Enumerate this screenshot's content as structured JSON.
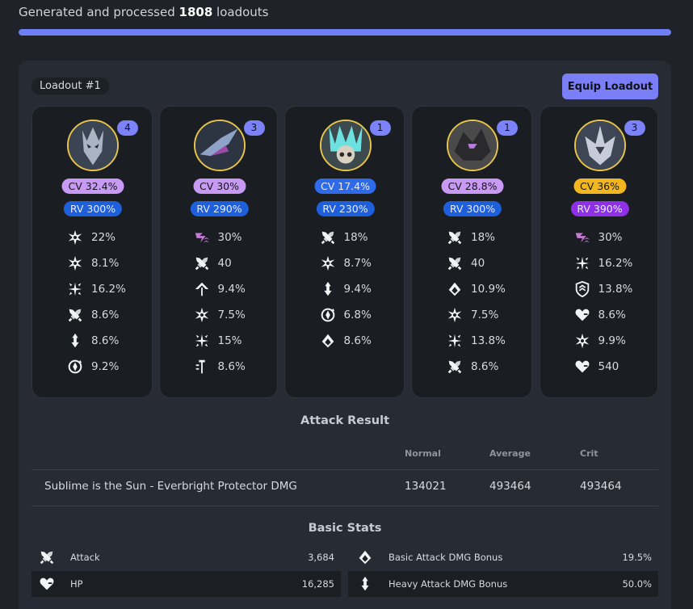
{
  "header": {
    "generated_prefix": "Generated and processed",
    "generated_count": "1808",
    "generated_suffix": "loadouts",
    "progress": 1.0
  },
  "loadout": {
    "tag": "Loadout #1",
    "equip_label": "Equip Loadout"
  },
  "colors": {
    "accent": "#7a7ff7",
    "avatar_ring": "#e7c44a",
    "cv_purple": "#c99af4",
    "cv_blue": "#2f6ae9",
    "cv_gold": "#f2b71e",
    "rv_blue": "#1e5fdc",
    "rv_purple": "#8f2fe8"
  },
  "cards": [
    {
      "count": "4",
      "cv": "CV 32.4%",
      "rv": "RV 300%",
      "cv_color": "cv_purple",
      "rv_color": "rv_blue",
      "stats": [
        {
          "icon": "crit-rate-icon",
          "value": "22%"
        },
        {
          "icon": "crit-rate-icon",
          "value": "8.1%"
        },
        {
          "icon": "crit-dmg-icon",
          "value": "16.2%"
        },
        {
          "icon": "attack-icon",
          "value": "8.6%"
        },
        {
          "icon": "heavy-attack-icon",
          "value": "8.6%"
        },
        {
          "icon": "energy-regen-icon",
          "value": "9.2%"
        }
      ]
    },
    {
      "count": "3",
      "cv": "CV 30%",
      "rv": "RV 290%",
      "cv_color": "cv_purple",
      "rv_color": "rv_blue",
      "stats": [
        {
          "icon": "havoc-dmg-icon",
          "value": "30%"
        },
        {
          "icon": "attack-icon",
          "value": "40"
        },
        {
          "icon": "liberation-icon",
          "value": "9.4%"
        },
        {
          "icon": "crit-rate-icon",
          "value": "7.5%"
        },
        {
          "icon": "crit-dmg-icon",
          "value": "15%"
        },
        {
          "icon": "skill-icon",
          "value": "8.6%"
        }
      ]
    },
    {
      "count": "1",
      "cv": "CV 17.4%",
      "rv": "RV 230%",
      "cv_color": "cv_blue",
      "rv_color": "rv_blue",
      "stats": [
        {
          "icon": "attack-icon",
          "value": "18%"
        },
        {
          "icon": "crit-rate-icon",
          "value": "8.7%"
        },
        {
          "icon": "heavy-attack-icon",
          "value": "9.4%"
        },
        {
          "icon": "energy-regen-icon",
          "value": "6.8%"
        },
        {
          "icon": "basic-attack-icon",
          "value": "8.6%"
        }
      ]
    },
    {
      "count": "1",
      "cv": "CV 28.8%",
      "rv": "RV 300%",
      "cv_color": "cv_purple",
      "rv_color": "rv_blue",
      "stats": [
        {
          "icon": "attack-icon",
          "value": "18%"
        },
        {
          "icon": "attack-icon",
          "value": "40"
        },
        {
          "icon": "basic-attack-icon",
          "value": "10.9%"
        },
        {
          "icon": "crit-rate-icon",
          "value": "7.5%"
        },
        {
          "icon": "crit-dmg-icon",
          "value": "13.8%"
        },
        {
          "icon": "attack-icon",
          "value": "8.6%"
        }
      ]
    },
    {
      "count": "3",
      "cv": "CV 36%",
      "rv": "RV 390%",
      "cv_color": "cv_gold",
      "rv_color": "rv_purple",
      "stats": [
        {
          "icon": "havoc-dmg-icon",
          "value": "30%"
        },
        {
          "icon": "crit-dmg-icon",
          "value": "16.2%"
        },
        {
          "icon": "defense-icon",
          "value": "13.8%"
        },
        {
          "icon": "hp-icon",
          "value": "8.6%"
        },
        {
          "icon": "crit-rate-icon",
          "value": "9.9%"
        },
        {
          "icon": "hp-icon",
          "value": "540"
        }
      ]
    }
  ],
  "attack_result": {
    "title": "Attack Result",
    "columns": [
      "Normal",
      "Average",
      "Crit"
    ],
    "rows": [
      {
        "name": "Sublime is the Sun - Everbright Protector DMG",
        "normal": "134021",
        "average": "493464",
        "crit": "493464"
      }
    ]
  },
  "basic_stats": {
    "title": "Basic Stats",
    "left": [
      {
        "icon": "attack-icon",
        "label": "Attack",
        "value": "3,684"
      },
      {
        "icon": "hp-icon",
        "label": "HP",
        "value": "16,285"
      }
    ],
    "right": [
      {
        "icon": "basic-attack-icon",
        "label": "Basic Attack DMG Bonus",
        "value": "19.5%"
      },
      {
        "icon": "heavy-attack-icon",
        "label": "Heavy Attack DMG Bonus",
        "value": "50.0%"
      }
    ]
  }
}
